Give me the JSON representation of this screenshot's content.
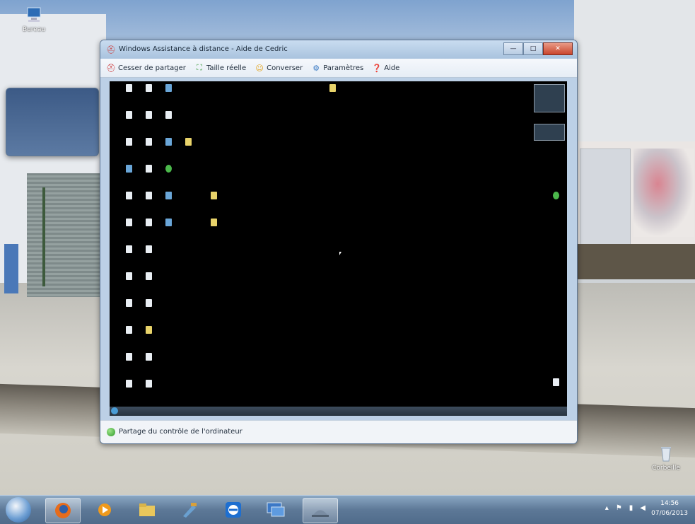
{
  "desktop": {
    "icons": [
      {
        "label": "Bureau",
        "icon": "computer-icon"
      },
      {
        "label": "Corbeille",
        "icon": "recycle-bin-icon"
      }
    ]
  },
  "window": {
    "title": "Windows Assistance à distance - Aide de Cedric",
    "title_icon": "remote-assistance-icon",
    "controls": {
      "minimize": "—",
      "maximize": "□",
      "close": "✕"
    },
    "toolbar": [
      {
        "label": "Cesser de partager",
        "icon": "stop-sharing-icon"
      },
      {
        "label": "Taille réelle",
        "icon": "actual-size-icon"
      },
      {
        "label": "Converser",
        "icon": "chat-icon"
      },
      {
        "label": "Paramètres",
        "icon": "settings-icon"
      },
      {
        "label": "Aide",
        "icon": "help-icon"
      }
    ],
    "status_text": "Partage du contrôle de l'ordinateur",
    "status_color": "#2f9a2a"
  },
  "taskbar": {
    "buttons": [
      "start-button",
      "firefox-icon",
      "media-player-icon",
      "explorer-icon",
      "tool-icon",
      "teamviewer-icon",
      "remote-desktop-icon",
      "remote-assistance-icon"
    ],
    "clock_time": "14:56",
    "clock_date": "07/06/2013"
  },
  "colors": {
    "accent": "#c9442c",
    "remote_background": "#000000"
  }
}
